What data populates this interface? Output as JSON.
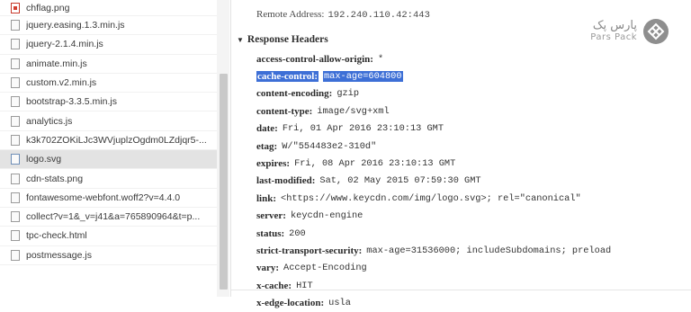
{
  "files": [
    {
      "name": "chflag.png",
      "icon": "png-image-icon"
    },
    {
      "name": "jquery.easing.1.3.min.js",
      "icon": "file-icon"
    },
    {
      "name": "jquery-2.1.4.min.js",
      "icon": "file-icon"
    },
    {
      "name": "animate.min.js",
      "icon": "file-icon"
    },
    {
      "name": "custom.v2.min.js",
      "icon": "file-icon"
    },
    {
      "name": "bootstrap-3.3.5.min.js",
      "icon": "file-icon"
    },
    {
      "name": "analytics.js",
      "icon": "file-icon"
    },
    {
      "name": "k3k702ZOKiLJc3WVjuplzOgdm0LZdjqr5-...",
      "icon": "file-icon"
    },
    {
      "name": "logo.svg",
      "icon": "svg-file-icon",
      "selected": true
    },
    {
      "name": "cdn-stats.png",
      "icon": "file-icon"
    },
    {
      "name": "fontawesome-webfont.woff2?v=4.4.0",
      "icon": "file-icon"
    },
    {
      "name": "collect?v=1&_v=j41&a=765890964&t=p...",
      "icon": "file-icon"
    },
    {
      "name": "tpc-check.html",
      "icon": "file-icon"
    },
    {
      "name": "postmessage.js",
      "icon": "file-icon"
    }
  ],
  "remote": {
    "label": "Remote Address:",
    "value": "192.240.110.42:443"
  },
  "response_headers": {
    "title": "Response Headers",
    "items": [
      {
        "name": "access-control-allow-origin:",
        "value": "*"
      },
      {
        "name": "cache-control:",
        "value": "max-age=604800",
        "highlighted": true
      },
      {
        "name": "content-encoding:",
        "value": "gzip"
      },
      {
        "name": "content-type:",
        "value": "image/svg+xml"
      },
      {
        "name": "date:",
        "value": "Fri, 01 Apr 2016 23:10:13 GMT"
      },
      {
        "name": "etag:",
        "value": "W/\"554483e2-310d\""
      },
      {
        "name": "expires:",
        "value": "Fri, 08 Apr 2016 23:10:13 GMT"
      },
      {
        "name": "last-modified:",
        "value": "Sat, 02 May 2015 07:59:30 GMT"
      },
      {
        "name": "link:",
        "value": "<https://www.keycdn.com/img/logo.svg>; rel=\"canonical\""
      },
      {
        "name": "server:",
        "value": "keycdn-engine"
      },
      {
        "name": "status:",
        "value": "200"
      },
      {
        "name": "strict-transport-security:",
        "value": "max-age=31536000; includeSubdomains; preload"
      },
      {
        "name": "vary:",
        "value": "Accept-Encoding"
      },
      {
        "name": "x-cache:",
        "value": "HIT"
      },
      {
        "name": "x-edge-location:",
        "value": "usla"
      }
    ]
  },
  "logo": {
    "text_fa": "پارس پک",
    "text_en": "Pars Pack"
  },
  "colors": {
    "highlight": "#3d6fd6",
    "selected_row": "#e3e3e3"
  }
}
